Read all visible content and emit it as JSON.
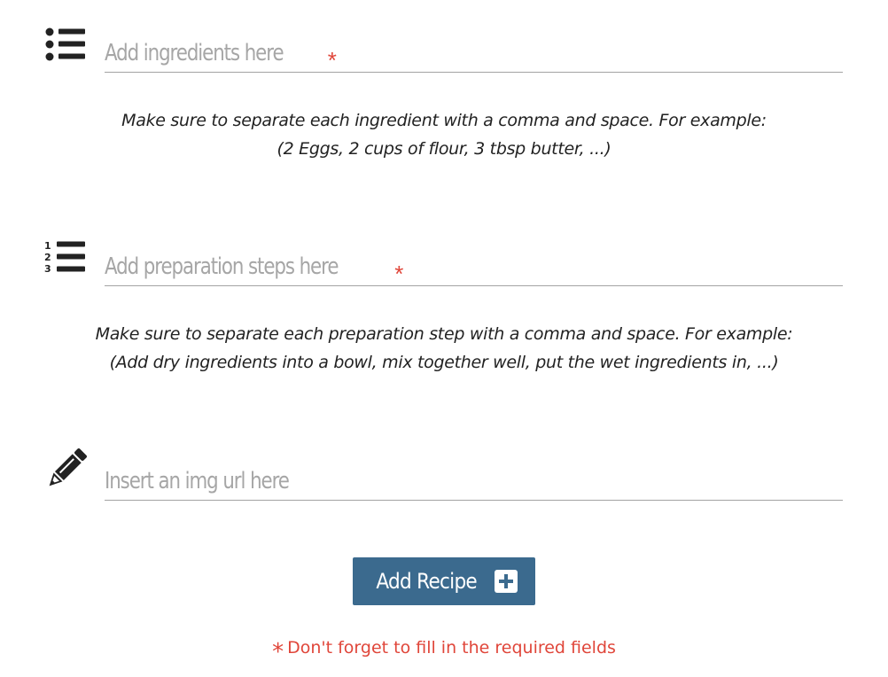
{
  "form": {
    "ingredients": {
      "icon": "list-icon",
      "placeholder": "Add ingredients here",
      "required_mark": "*",
      "hint_line1": "Make sure to separate each ingredient with a comma and space. For example:",
      "hint_line2": "(2 Eggs, 2 cups of flour, 3 tbsp butter, ...)"
    },
    "steps": {
      "icon": "numbered-list-icon",
      "placeholder": "Add preparation steps here",
      "required_mark": "*",
      "hint_line1": "Make sure to separate each preparation step with a comma and space. For example:",
      "hint_line2": "(Add dry ingredients into a bowl, mix together well, put the wet ingredients in, ...)"
    },
    "image": {
      "icon": "pencil-icon",
      "placeholder": "Insert an img url here"
    },
    "submit": {
      "label": "Add Recipe",
      "icon": "plus-square-icon"
    },
    "warning": {
      "mark": "*",
      "text": "Don't forget to fill in the required fields"
    }
  },
  "colors": {
    "button_bg": "#3b6a8e",
    "required": "#e0463a",
    "placeholder": "#a6a6a6",
    "icon": "#222222"
  }
}
